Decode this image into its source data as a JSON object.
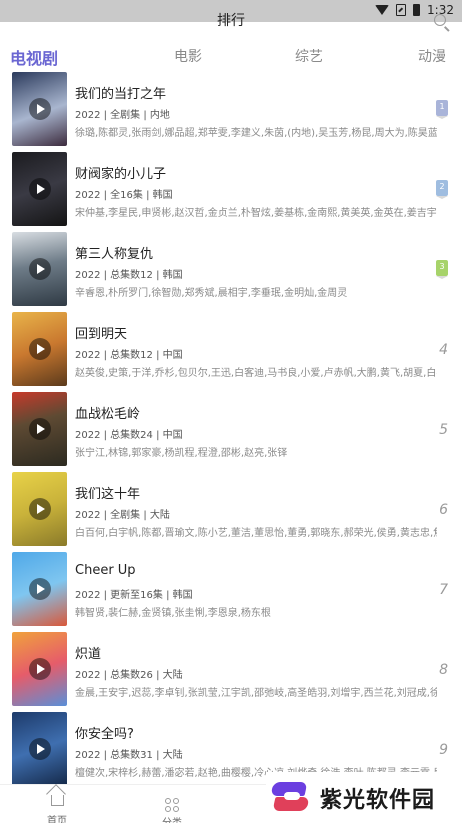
{
  "status_bar": {
    "time": "1:32"
  },
  "header": {
    "title": "排行"
  },
  "tabs": [
    {
      "label": "电视剧",
      "active": true
    },
    {
      "label": "电影",
      "active": false
    },
    {
      "label": "综艺",
      "active": false
    },
    {
      "label": "动漫",
      "active": false
    }
  ],
  "items": [
    {
      "title": "我们的当打之年",
      "meta": "2022 | 全剧集 | 内地",
      "cast": "徐璐,陈都灵,张雨剑,娜品超,郑苹雯,李建义,朱茵,(内地),吴玉芳,杨昆,周大为,陈昊蓝",
      "rank": "1",
      "badge_color": "#a9b4d9"
    },
    {
      "title": "财阀家的小儿子",
      "meta": "2022 | 全16集 | 韩国",
      "cast": "宋仲基,李星民,申贤彬,赵汉哲,金贞兰,朴智炫,姜基栋,金南熙,黄美英,金英在,姜吉宇",
      "rank": "2",
      "badge_color": "#9fbde0"
    },
    {
      "title": "第三人称复仇",
      "meta": "2022 | 总集数12 | 韩国",
      "cast": "辛睿恩,朴所罗门,徐智勋,郑秀斌,晨相宇,李垂珉,金明灿,金周灵",
      "rank": "3",
      "badge_color": "#a7d36a"
    },
    {
      "title": "回到明天",
      "meta": "2022 | 总集数12 | 中国",
      "cast": "赵英俊,史策,于洋,乔杉,包贝尔,王迅,白客迪,马书良,小爱,卢赤帆,大鹏,黄飞,胡夏,白客,崔志…",
      "rank": "4"
    },
    {
      "title": "血战松毛岭",
      "meta": "2022 | 总集数24 | 中国",
      "cast": "张宁江,林锦,郭家豪,杨凯程,程澄,邵彬,赵亮,张铎",
      "rank": "5"
    },
    {
      "title": "我们这十年",
      "meta": "2022 | 全剧集 | 大陆",
      "cast": "白百何,白宇帆,陈都,晋瑜文,陈小艺,董洁,董思怡,董勇,郭晓东,郝荣光,侯勇,黄志忠,焦俊艳,…",
      "rank": "6"
    },
    {
      "title": "Cheer Up",
      "meta": "2022 | 更新至16集 | 韩国",
      "cast": "韩智贤,裴仁赫,金贤镇,张圭悧,李恩泉,杨东根",
      "rank": "7"
    },
    {
      "title": "炽道",
      "meta": "2022 | 总集数26 | 大陆",
      "cast": "金晨,王安宇,迟蕊,李卓钊,张凯莹,江宇凯,邵弛岐,高圣皓羽,刘增宇,西兰花,刘冠成,徐浩儿",
      "rank": "8"
    },
    {
      "title": "你安全吗?",
      "meta": "2022 | 总集数31 | 大陆",
      "cast": "檀健次,宋梓杉,赫蕾,潘宓若,赵艳,曲樱樱,冷心凉,刘烨奇,徐浩,李叶,陈都灵,李元霖,尼大峰",
      "rank": "9"
    }
  ],
  "bottom_nav": [
    {
      "label": "首页",
      "icon": "home-icon"
    },
    {
      "label": "分类",
      "icon": "grid-icon"
    }
  ],
  "watermark": {
    "text": "紫光软件园"
  }
}
